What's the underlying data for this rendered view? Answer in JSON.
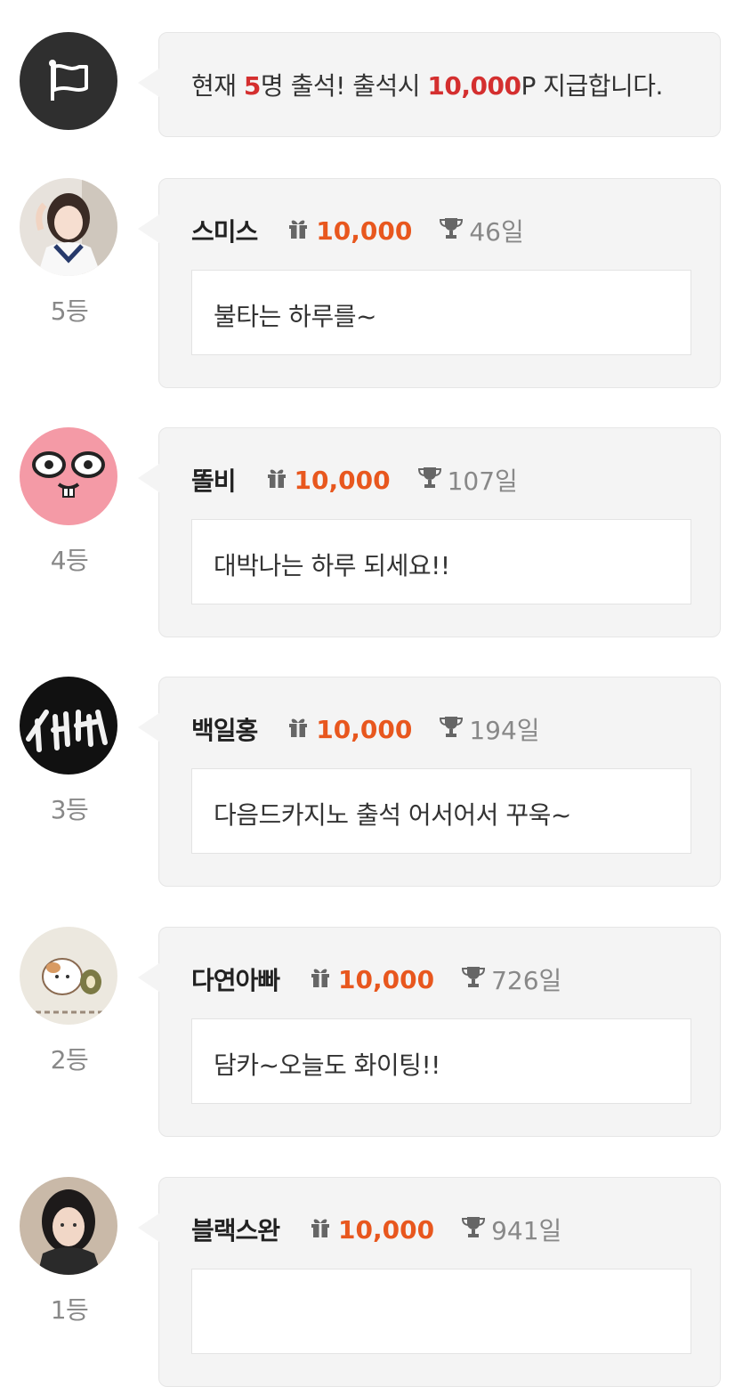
{
  "notice": {
    "prefix": "현재 ",
    "count": "5",
    "mid": "명 출석! 출석시 ",
    "points": "10,000",
    "suffix": "P 지급합니다."
  },
  "entries": [
    {
      "rank": "5등",
      "name": "스미스",
      "points": "10,000",
      "days": "46일",
      "message": "불타는 하루를~"
    },
    {
      "rank": "4등",
      "name": "똘비",
      "points": "10,000",
      "days": "107일",
      "message": "대박나는 하루 되세요!!"
    },
    {
      "rank": "3등",
      "name": "백일홍",
      "points": "10,000",
      "days": "194일",
      "message": "다음드카지노 출석 어서어서 꾸욱~"
    },
    {
      "rank": "2등",
      "name": "다연아빠",
      "points": "10,000",
      "days": "726일",
      "message": "담카~오늘도 화이팅!!"
    },
    {
      "rank": "1등",
      "name": "블랙스완",
      "points": "10,000",
      "days": "941일",
      "message": ""
    }
  ],
  "colors": {
    "accent_points": "#e8571e",
    "accent_notice": "#d42f2f",
    "card_bg": "#f4f4f4"
  },
  "icons": {
    "notice": "flag-icon",
    "points": "gift-icon",
    "days": "trophy-icon"
  }
}
